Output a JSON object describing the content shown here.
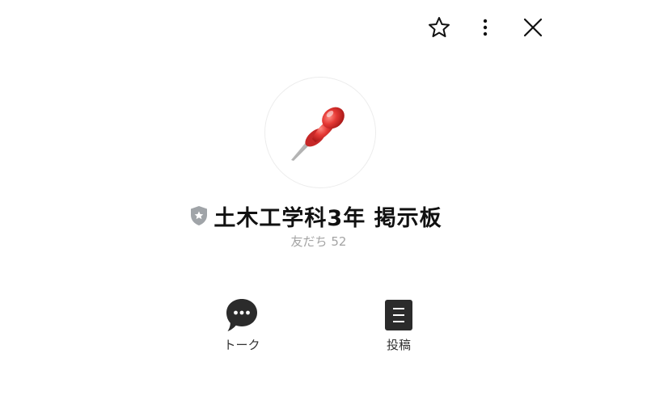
{
  "header": {
    "favorite_icon": "star-outline-icon",
    "more_icon": "more-vertical-icon",
    "close_icon": "close-icon"
  },
  "profile": {
    "avatar_icon": "red-pushpin-icon",
    "badge_icon": "official-shield-icon",
    "name": "土木工学科3年 掲示板",
    "friends_label": "友だち",
    "friends_count": "52"
  },
  "actions": [
    {
      "icon": "chat-bubble-icon",
      "label": "トーク"
    },
    {
      "icon": "document-icon",
      "label": "投稿"
    }
  ],
  "colors": {
    "badge": "#a0a4a8",
    "pin": "#e02020",
    "icon_dark": "#2b2b2b",
    "muted_text": "#a4a4a4"
  }
}
